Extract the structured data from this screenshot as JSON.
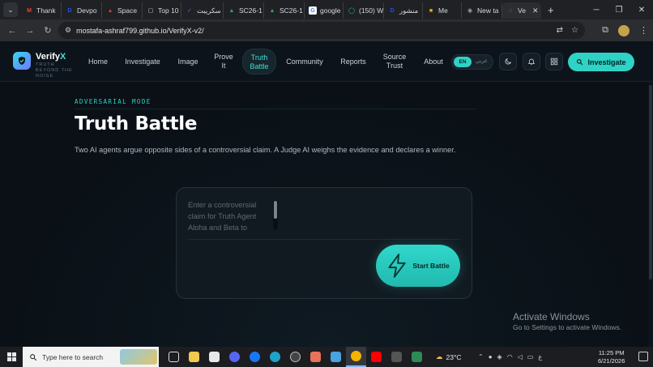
{
  "browser": {
    "tabs": [
      {
        "label": "Thank",
        "icon": "gmail-icon",
        "color": "#ea4335",
        "glyph": "M"
      },
      {
        "label": "Devpo",
        "icon": "devpost-icon",
        "color": "#1f4fff",
        "glyph": "D"
      },
      {
        "label": "Space",
        "icon": "space-icon",
        "color": "#d93a3a",
        "glyph": "▲"
      },
      {
        "label": "Top 10",
        "icon": "page-icon",
        "color": "#cfcfcf",
        "glyph": "▢"
      },
      {
        "label": "سكريبت",
        "icon": "script-icon",
        "color": "#5a6cf0",
        "glyph": "✓"
      },
      {
        "label": "SC26-1",
        "icon": "drive-icon",
        "color": "#34a853",
        "glyph": "▲"
      },
      {
        "label": "SC26-1",
        "icon": "drive-icon",
        "color": "#34a853",
        "glyph": "▲"
      },
      {
        "label": "google",
        "icon": "google-icon",
        "color": "#ffffff",
        "glyph": "G"
      },
      {
        "label": "(150) W",
        "icon": "whatsapp-icon",
        "color": "#25d366",
        "glyph": "◯"
      },
      {
        "label": "منشور",
        "icon": "devpost-icon",
        "color": "#1f4fff",
        "glyph": "D"
      },
      {
        "label": "Me",
        "icon": "meet-icon",
        "color": "#f9ab00",
        "glyph": "■"
      },
      {
        "label": "New ta",
        "icon": "chrome-icon",
        "color": "#9aa0a6",
        "glyph": "◉"
      },
      {
        "label": "Ve",
        "icon": "globe-icon",
        "color": "#9aa0a6",
        "glyph": "◌",
        "active": true
      }
    ],
    "new_tab": "+",
    "url": "mostafa-ashraf799.github.io/VerifyX-v2/"
  },
  "site": {
    "brand_main": "Verify",
    "brand_accent": "X",
    "tagline": "TRUTH BEYOND THE NOISE",
    "nav": [
      {
        "label": "Home"
      },
      {
        "label": "Investigate"
      },
      {
        "label": "Image"
      },
      {
        "label": "Prove It"
      },
      {
        "label": "Truth Battle",
        "active": true
      },
      {
        "label": "Community"
      },
      {
        "label": "Reports"
      },
      {
        "label": "Source Trust"
      },
      {
        "label": "About"
      }
    ],
    "lang_en": "EN",
    "lang_ar": "عربي",
    "cta": "Investigate",
    "accent": "#2ed3c6"
  },
  "page": {
    "eyebrow": "ADVERSARIAL MODE",
    "title": "Truth Battle",
    "subtitle": "Two AI agents argue opposite sides of a controversial claim. A Judge AI weighs the evidence and declares a winner.",
    "claim_placeholder": "Enter a controversial claim for Truth Agent Alpha and Beta to debate...",
    "start_label": "Start Battle"
  },
  "os": {
    "watermark_title": "Activate Windows",
    "watermark_sub": "Go to Settings to activate Windows.",
    "search_placeholder": "Type here to search",
    "weather": "23°C",
    "time": "11:25 PM",
    "date": "6/21/2026",
    "lang_indicator": "ع"
  }
}
